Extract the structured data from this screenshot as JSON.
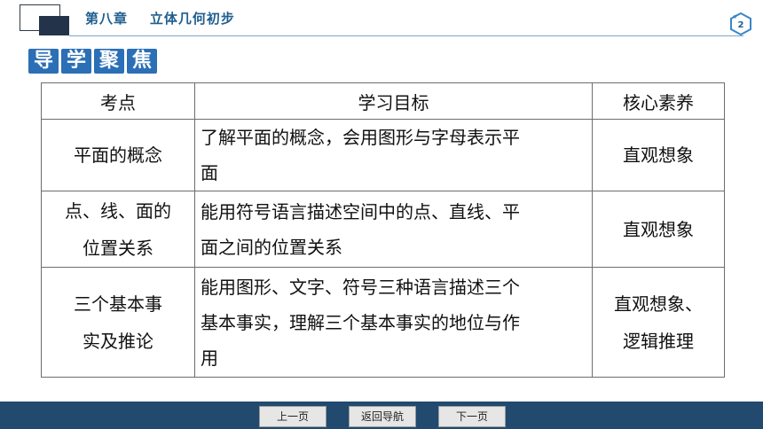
{
  "header": {
    "chapter_title": "第八章    立体几何初步",
    "page_number": "2"
  },
  "section": {
    "chars": [
      "导",
      "学",
      "聚",
      "焦"
    ]
  },
  "table": {
    "headers": [
      "考点",
      "学习目标",
      "核心素养"
    ],
    "rows": [
      {
        "topic_lines": [
          "平面的概念"
        ],
        "goal_lines": [
          "了解平面的概念，会用图形与字母表示平",
          "面"
        ],
        "literacy_lines": [
          "直观想象"
        ]
      },
      {
        "topic_lines": [
          "点、线、面的",
          "位置关系"
        ],
        "goal_lines": [
          "能用符号语言描述空间中的点、直线、平",
          "面之间的位置关系"
        ],
        "literacy_lines": [
          "直观想象"
        ]
      },
      {
        "topic_lines": [
          "三个基本事",
          "实及推论"
        ],
        "goal_lines": [
          "能用图形、文字、符号三种语言描述三个",
          "基本事实，理解三个基本事实的地位与作",
          "用"
        ],
        "literacy_lines": [
          "直观想象、",
          "逻辑推理"
        ]
      }
    ]
  },
  "nav": {
    "prev": "上一页",
    "home": "返回导航",
    "next": "下一页"
  },
  "colors": {
    "header_text": "#1f5e8f",
    "tag_bg": "#2b6fb6",
    "bottom_bar": "#214a6e"
  }
}
